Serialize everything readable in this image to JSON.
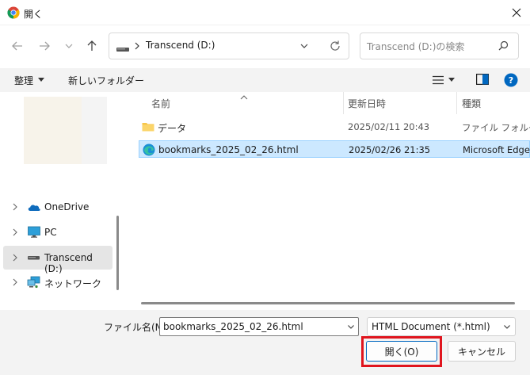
{
  "window": {
    "title": "開く",
    "close_icon": "close-icon"
  },
  "address": {
    "path": "Transcend (D:)",
    "search_placeholder": "Transcend (D:)の検索"
  },
  "toolbar": {
    "organize_label": "整理",
    "new_folder_label": "新しいフォルダー"
  },
  "nav_pane": {
    "items": [
      {
        "label": "OneDrive",
        "icon": "onedrive-cloud-icon"
      },
      {
        "label": "PC",
        "icon": "pc-monitor-icon"
      },
      {
        "label": "Transcend (D:)",
        "icon": "drive-icon",
        "selected": true
      },
      {
        "label": "ネットワーク",
        "icon": "network-icon"
      }
    ]
  },
  "file_list": {
    "columns": [
      "名前",
      "更新日時",
      "種類"
    ],
    "rows": [
      {
        "name": "データ",
        "modified": "2025/02/11 20:43",
        "type": "ファイル フォルダー",
        "icon": "folder-icon"
      },
      {
        "name": "bookmarks_2025_02_26.html",
        "modified": "2025/02/26 21:35",
        "type": "Microsoft Edge HTML Document",
        "icon": "edge-html-icon",
        "selected": true
      }
    ]
  },
  "bottom": {
    "filename_label": "ファイル名(N):",
    "filename_value": "bookmarks_2025_02_26.html",
    "filetype_value": "HTML Document (*.html)",
    "open_label": "開く(O)",
    "cancel_label": "キャンセル"
  },
  "colors": {
    "accent": "#0067c0",
    "selection": "#cce8ff",
    "highlight_box": "#e0151e"
  }
}
